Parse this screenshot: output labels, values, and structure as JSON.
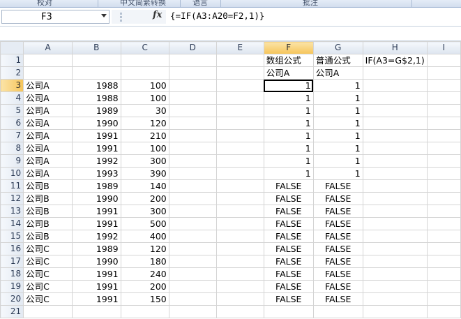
{
  "ribbon": {
    "groups": [
      "校对",
      "中文简繁转换",
      "语言",
      "批注"
    ]
  },
  "formula_bar": {
    "name_box": "F3",
    "fx_label": "fx",
    "formula": "{=IF(A3:A20=F2,1)}"
  },
  "sheet": {
    "columns": [
      "A",
      "B",
      "C",
      "D",
      "E",
      "F",
      "G",
      "H",
      "I"
    ],
    "selected_column": "F",
    "selected_row": "3",
    "header_row1": {
      "F": "数组公式",
      "G": "普通公式",
      "H": "IF(A3=G$2,1)"
    },
    "header_row2": {
      "F": "公司A",
      "G": "公司A"
    },
    "rows": [
      {
        "num": "1"
      },
      {
        "num": "2"
      },
      {
        "num": "3",
        "a": "公司A",
        "b": "1988",
        "c": "100",
        "f": "1",
        "g": "1"
      },
      {
        "num": "4",
        "a": "公司A",
        "b": "1988",
        "c": "100",
        "f": "1",
        "g": "1"
      },
      {
        "num": "5",
        "a": "公司A",
        "b": "1989",
        "c": "30",
        "f": "1",
        "g": "1"
      },
      {
        "num": "6",
        "a": "公司A",
        "b": "1990",
        "c": "120",
        "f": "1",
        "g": "1"
      },
      {
        "num": "7",
        "a": "公司A",
        "b": "1991",
        "c": "210",
        "f": "1",
        "g": "1"
      },
      {
        "num": "8",
        "a": "公司A",
        "b": "1991",
        "c": "100",
        "f": "1",
        "g": "1"
      },
      {
        "num": "9",
        "a": "公司A",
        "b": "1992",
        "c": "300",
        "f": "1",
        "g": "1"
      },
      {
        "num": "10",
        "a": "公司A",
        "b": "1993",
        "c": "390",
        "f": "1",
        "g": "1"
      },
      {
        "num": "11",
        "a": "公司B",
        "b": "1989",
        "c": "140",
        "f": "FALSE",
        "g": "FALSE"
      },
      {
        "num": "12",
        "a": "公司B",
        "b": "1990",
        "c": "200",
        "f": "FALSE",
        "g": "FALSE"
      },
      {
        "num": "13",
        "a": "公司B",
        "b": "1991",
        "c": "300",
        "f": "FALSE",
        "g": "FALSE"
      },
      {
        "num": "14",
        "a": "公司B",
        "b": "1991",
        "c": "500",
        "f": "FALSE",
        "g": "FALSE"
      },
      {
        "num": "15",
        "a": "公司B",
        "b": "1992",
        "c": "400",
        "f": "FALSE",
        "g": "FALSE"
      },
      {
        "num": "16",
        "a": "公司C",
        "b": "1989",
        "c": "120",
        "f": "FALSE",
        "g": "FALSE"
      },
      {
        "num": "17",
        "a": "公司C",
        "b": "1990",
        "c": "180",
        "f": "FALSE",
        "g": "FALSE"
      },
      {
        "num": "18",
        "a": "公司C",
        "b": "1991",
        "c": "240",
        "f": "FALSE",
        "g": "FALSE"
      },
      {
        "num": "19",
        "a": "公司C",
        "b": "1991",
        "c": "200",
        "f": "FALSE",
        "g": "FALSE"
      },
      {
        "num": "20",
        "a": "公司C",
        "b": "1991",
        "c": "150",
        "f": "FALSE",
        "g": "FALSE"
      },
      {
        "num": "21"
      }
    ]
  }
}
